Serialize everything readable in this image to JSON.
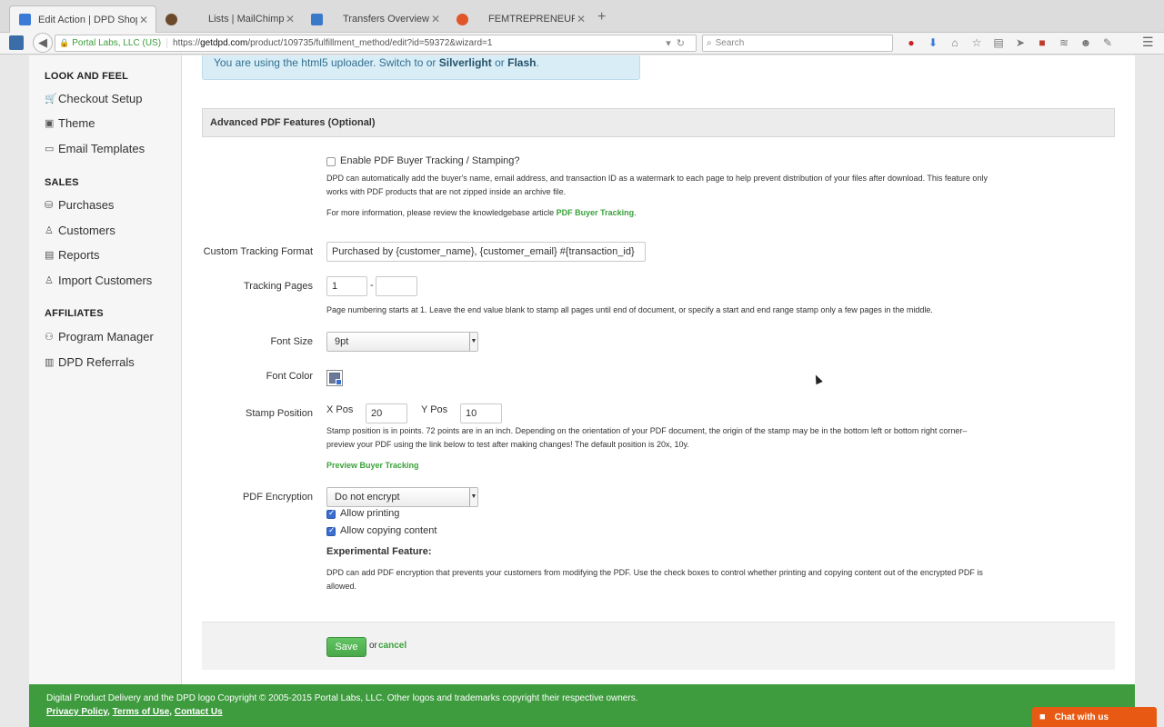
{
  "browser": {
    "tabs": [
      {
        "label": "Edit Action | DPD Shopping ...",
        "active": true,
        "favicon_color": "#3b7bd6"
      },
      {
        "label": "Lists | MailChimp",
        "active": false,
        "favicon_color": "#6b4a2c"
      },
      {
        "label": "Transfers Overview",
        "active": false,
        "favicon_color": "#3a78c9"
      },
      {
        "label": "FEMTREPRENEUR",
        "active": false,
        "favicon_color": "#e0562a"
      }
    ],
    "identity": "Portal Labs, LLC (US)",
    "url_prefix": "https://",
    "url_domain": "getdpd.com",
    "url_path": "/product/109735/fulfillment_method/edit?id=59372&wizard=1",
    "search_placeholder": "Search"
  },
  "sidebar": {
    "look_heading": "LOOK AND FEEL",
    "look_items": [
      "Checkout Setup",
      "Theme",
      "Email Templates"
    ],
    "sales_heading": "SALES",
    "sales_items": [
      "Purchases",
      "Customers",
      "Reports",
      "Import Customers"
    ],
    "affiliates_heading": "AFFILIATES",
    "affiliates_items": [
      "Program Manager",
      "DPD Referrals"
    ]
  },
  "alert": {
    "text": "You are using the html5 uploader. Switch to or",
    "link1": "Silverlight",
    "or": "or",
    "link2": "Flash",
    "end": "."
  },
  "panel": {
    "title": "Advanced PDF Features (Optional)",
    "enable_label": "Enable PDF Buyer Tracking / Stamping?",
    "enable_checked": false,
    "desc1a": "DPD can automatically add the buyer's name, email address, and transaction ID as a watermark to each page to help prevent distribution of your files after download. This feature only",
    "desc1b": "works with PDF products that are not zipped inside an archive file.",
    "desc2": "For more information, please review the knowledgebase article",
    "desc2_link": "PDF Buyer Tracking",
    "desc2_end": ".",
    "tracking_format_label": "Custom Tracking Format",
    "tracking_format_value": "Purchased by {customer_name}, {customer_email} #{transaction_id}",
    "tracking_pages_label": "Tracking Pages",
    "tracking_pages_start": "1",
    "tracking_pages_sep": "-",
    "tracking_pages_end": "",
    "tracking_pages_help": "Page numbering starts at 1. Leave the end value blank to stamp all pages until end of document, or specify a start and end range stamp only a few pages in the middle.",
    "font_size_label": "Font Size",
    "font_size_value": "9pt",
    "font_color_label": "Font Color",
    "stamp_label": "Stamp Position",
    "xpos_label": "X Pos",
    "xpos_value": "20",
    "ypos_label": "Y Pos",
    "ypos_value": "10",
    "stamp_help1": "Stamp position is in points. 72 points are in an inch. Depending on the orientation of your PDF document, the origin of the stamp may be in the bottom left or bottom right corner–",
    "stamp_help2": "preview your PDF using the link below to test after making changes! The default position is 20x, 10y.",
    "preview_link": "Preview Buyer Tracking",
    "encryption_label": "PDF Encryption",
    "encryption_value": "Do not encrypt",
    "allow_printing": "Allow printing",
    "allow_copying": "Allow copying content",
    "experimental_heading": "Experimental Feature:",
    "experimental_a": "DPD can add PDF encryption that prevents your customers from modifying the PDF. Use the check boxes to control whether printing and copying content out of the encrypted PDF is",
    "experimental_b": "allowed."
  },
  "actions": {
    "save": "Save",
    "or": "or",
    "cancel": "cancel"
  },
  "footer": {
    "copyright": "Digital Product Delivery and the DPD logo Copyright © 2005-2015 Portal Labs, LLC. Other logos and trademarks copyright their respective owners.",
    "privacy": "Privacy Policy",
    "terms": "Terms of Use",
    "contact": "Contact Us",
    "sep": ","
  },
  "chat": {
    "label": "Chat with us"
  },
  "colors": {
    "brand_green": "#3e9b3e",
    "link_green": "#3aa13a",
    "chat_orange": "#e85a13",
    "alert_blue": "#d9edf7"
  }
}
